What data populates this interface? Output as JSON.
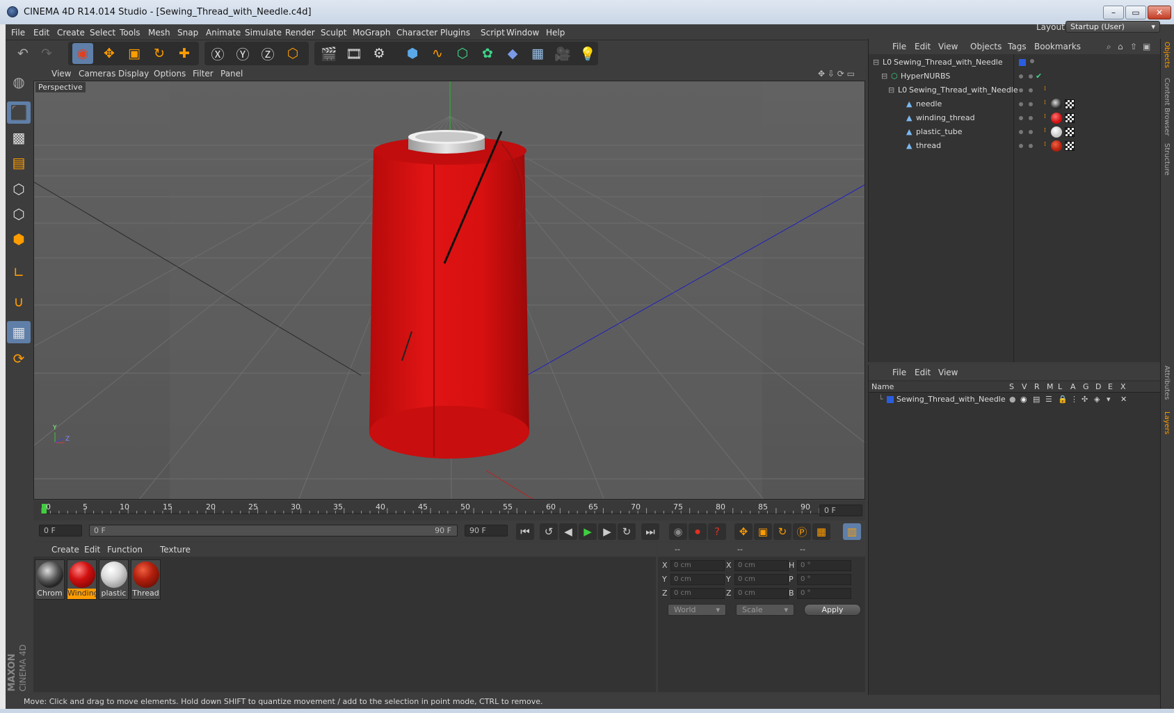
{
  "window": {
    "title": "CINEMA 4D R14.014 Studio - [Sewing_Thread_with_Needle.c4d]",
    "minimize": "–",
    "maximize": "▭",
    "close": "✕"
  },
  "menubar": {
    "items": [
      "File",
      "Edit",
      "Create",
      "Select",
      "Tools",
      "Mesh",
      "Snap",
      "Animate",
      "Simulate",
      "Render",
      "Sculpt",
      "MoGraph",
      "Character",
      "Plugins",
      "Script",
      "Window",
      "Help"
    ],
    "layout_label": "Layout:",
    "layout_value": "Startup (User)"
  },
  "viewport": {
    "menu": [
      "View",
      "Cameras",
      "Display",
      "Options",
      "Filter",
      "Panel"
    ],
    "label": "Perspective",
    "axis_y": "Y",
    "axis_z": "Z"
  },
  "timeline": {
    "ticks": [
      "0",
      "5",
      "10",
      "15",
      "20",
      "25",
      "30",
      "35",
      "40",
      "45",
      "50",
      "55",
      "60",
      "65",
      "70",
      "75",
      "80",
      "85",
      "90"
    ],
    "current_frame": "0 F",
    "start_field": "0 F",
    "range_start": "0 F",
    "range_end": "90 F",
    "end_field": "90 F"
  },
  "materials": {
    "menu": [
      "Create",
      "Edit",
      "Function",
      "Texture"
    ],
    "items": [
      {
        "label": "Chrom",
        "color": "#6b6b6b"
      },
      {
        "label": "Winding",
        "color": "#d01010",
        "selected": true
      },
      {
        "label": "plastic",
        "color": "#d8d8d8"
      },
      {
        "label": "Thread",
        "color": "#b3200e"
      }
    ]
  },
  "coordinates": {
    "headers": [
      "--",
      "--",
      "--"
    ],
    "rows": [
      {
        "l1": "X",
        "v1": "0 cm",
        "l2": "X",
        "v2": "0 cm",
        "l3": "H",
        "v3": "0 °"
      },
      {
        "l1": "Y",
        "v1": "0 cm",
        "l2": "Y",
        "v2": "0 cm",
        "l3": "P",
        "v3": "0 °"
      },
      {
        "l1": "Z",
        "v1": "0 cm",
        "l2": "Z",
        "v2": "0 cm",
        "l3": "B",
        "v3": "0 °"
      }
    ],
    "space": "World",
    "mode": "Scale",
    "apply": "Apply"
  },
  "objects": {
    "menu": [
      "File",
      "Edit",
      "View",
      "Objects",
      "Tags",
      "Bookmarks"
    ],
    "rows": [
      {
        "name": "Sewing_Thread_with_Needle",
        "indent": 0,
        "icon": "L0"
      },
      {
        "name": "HyperNURBS",
        "indent": 1,
        "icon": "nurbs"
      },
      {
        "name": "Sewing_Thread_with_Needle",
        "indent": 2,
        "icon": "L0"
      },
      {
        "name": "needle",
        "indent": 3,
        "icon": "poly",
        "tag": "#2a2a2a"
      },
      {
        "name": "winding_thread",
        "indent": 3,
        "icon": "poly",
        "tag": "#d01010"
      },
      {
        "name": "plastic_tube",
        "indent": 3,
        "icon": "poly",
        "tag": "#c8c8c8"
      },
      {
        "name": "thread",
        "indent": 3,
        "icon": "poly",
        "tag": "#b3200e"
      }
    ]
  },
  "layers": {
    "menu": [
      "File",
      "Edit",
      "View"
    ],
    "columns": [
      "Name",
      "S",
      "V",
      "R",
      "M",
      "L",
      "A",
      "G",
      "D",
      "E",
      "X"
    ],
    "rows": [
      {
        "name": "Sewing_Thread_with_Needle"
      }
    ]
  },
  "side_tabs": [
    "Objects",
    "Content Browser",
    "Structure",
    "Attributes",
    "Layers"
  ],
  "status": "Move: Click and drag to move elements. Hold down SHIFT to quantize movement / add to the selection in point mode, CTRL to remove.",
  "logo": {
    "line1": "MAXON",
    "line2": "CINEMA 4D"
  },
  "colors": {
    "accent": "#ff9c00",
    "selection": "#5f7fa8",
    "spool": "#d01010"
  }
}
